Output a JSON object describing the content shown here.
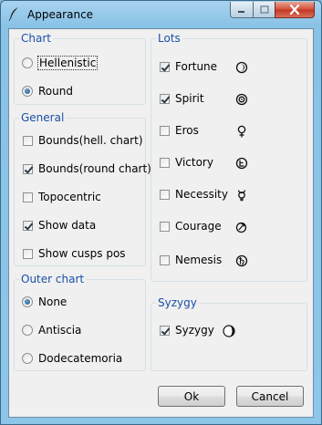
{
  "window": {
    "title": "Appearance",
    "icon": "quill-icon",
    "controls": {
      "minimize": "minimize-icon",
      "maximize": "maximize-icon",
      "close": "close-icon"
    }
  },
  "chart": {
    "label": "Chart",
    "options": [
      {
        "label": "Hellenistic",
        "selected": false
      },
      {
        "label": "Round",
        "selected": true
      }
    ]
  },
  "general": {
    "label": "General",
    "options": [
      {
        "label": "Bounds(hell. chart)",
        "checked": false
      },
      {
        "label": "Bounds(round chart)",
        "checked": true
      },
      {
        "label": "Topocentric",
        "checked": false
      },
      {
        "label": "Show data",
        "checked": true
      },
      {
        "label": "Show cusps pos",
        "checked": false
      }
    ]
  },
  "outer_chart": {
    "label": "Outer chart",
    "options": [
      {
        "label": "None",
        "selected": true
      },
      {
        "label": "Antiscia",
        "selected": false
      },
      {
        "label": "Dodecatemoria",
        "selected": false
      }
    ]
  },
  "lots": {
    "label": "Lots",
    "items": [
      {
        "label": "Fortune",
        "checked": true,
        "icon": "fortune-symbol-icon"
      },
      {
        "label": "Spirit",
        "checked": true,
        "icon": "spirit-symbol-icon"
      },
      {
        "label": "Eros",
        "checked": false,
        "icon": "eros-symbol-icon"
      },
      {
        "label": "Victory",
        "checked": false,
        "icon": "victory-symbol-icon"
      },
      {
        "label": "Necessity",
        "checked": false,
        "icon": "necessity-symbol-icon"
      },
      {
        "label": "Courage",
        "checked": false,
        "icon": "courage-symbol-icon"
      },
      {
        "label": "Nemesis",
        "checked": false,
        "icon": "nemesis-symbol-icon"
      }
    ]
  },
  "syzygy": {
    "label": "Syzygy",
    "item": {
      "label": "Syzygy",
      "checked": true,
      "icon": "moon-phase-icon"
    }
  },
  "buttons": {
    "ok": "Ok",
    "cancel": "Cancel"
  }
}
